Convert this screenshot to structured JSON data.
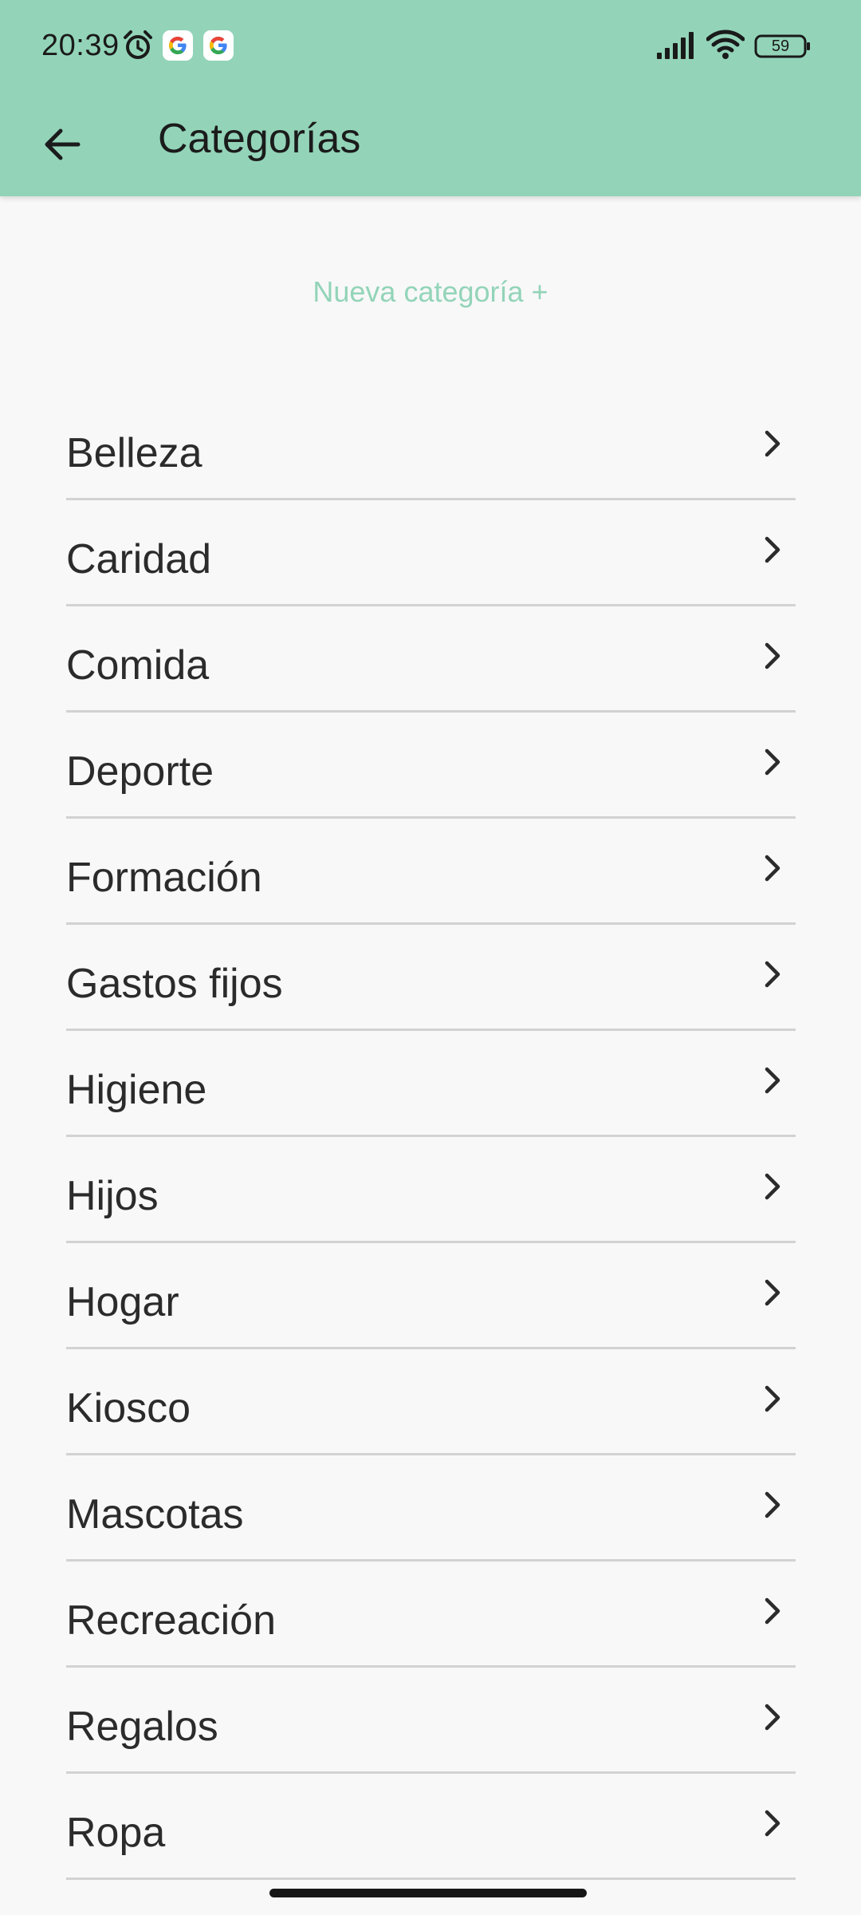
{
  "status_bar": {
    "time": "20:39",
    "battery": "59",
    "icons": [
      "alarm-icon",
      "google-icon",
      "google-icon",
      "signal-icon",
      "wifi-icon",
      "battery-icon"
    ]
  },
  "app_bar": {
    "title": "Categorías",
    "back_icon": "arrow-left-icon"
  },
  "new_category_label": "Nueva categoría +",
  "colors": {
    "accent": "#93d4b9",
    "background": "#f8f8f8",
    "divider": "#d2d2d2",
    "text": "#2b2b2b"
  },
  "categories": [
    {
      "label": "Belleza"
    },
    {
      "label": "Caridad"
    },
    {
      "label": "Comida"
    },
    {
      "label": "Deporte"
    },
    {
      "label": "Formación"
    },
    {
      "label": "Gastos fijos"
    },
    {
      "label": "Higiene"
    },
    {
      "label": "Hijos"
    },
    {
      "label": "Hogar"
    },
    {
      "label": "Kiosco"
    },
    {
      "label": "Mascotas"
    },
    {
      "label": "Recreación"
    },
    {
      "label": "Regalos"
    },
    {
      "label": "Ropa"
    }
  ]
}
